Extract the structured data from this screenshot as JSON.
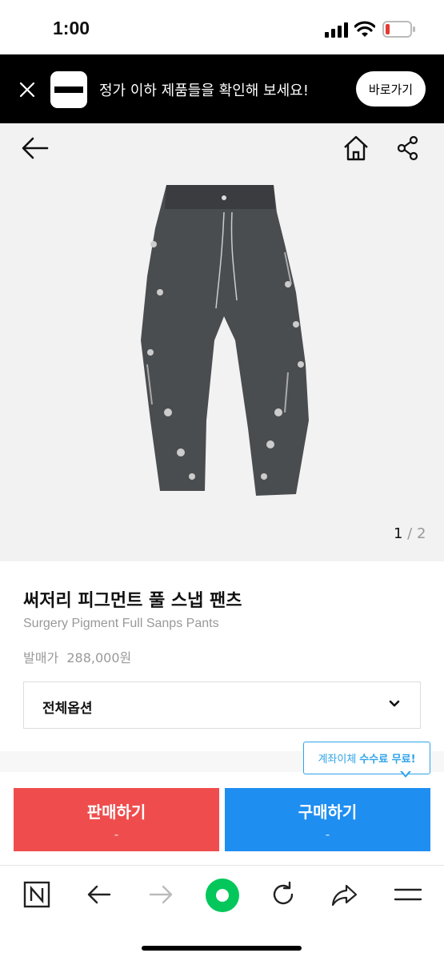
{
  "status": {
    "time": "1:00"
  },
  "banner": {
    "text": "정가 이하 제품들을 확인해 보세요!",
    "button_label": "바로가기"
  },
  "gallery": {
    "current": "1",
    "separator": " / ",
    "total": "2"
  },
  "product": {
    "title": "써저리 피그먼트 풀 스냅 팬츠",
    "subtitle": "Surgery Pigment Full Sanps Pants",
    "price_label": "발매가",
    "price_value": "288,000원",
    "option_label": "전체옵션"
  },
  "tooltip": {
    "text": "계좌이체",
    "emphasis": "수수료 무료!"
  },
  "actions": {
    "sell_label": "판매하기",
    "sell_price": "-",
    "buy_label": "구매하기",
    "buy_price": "-"
  },
  "colors": {
    "sell": "#ef4d4d",
    "buy": "#1f8ef1",
    "tooltip": "#2ea3e8",
    "naver_green": "#03c75a"
  },
  "icons": [
    "back-arrow-icon",
    "home-icon",
    "share-icon",
    "chevron-down-icon",
    "naver-n-icon",
    "browser-back-icon",
    "browser-forward-icon",
    "green-dot-icon",
    "refresh-icon",
    "browser-share-icon",
    "menu-icon"
  ]
}
